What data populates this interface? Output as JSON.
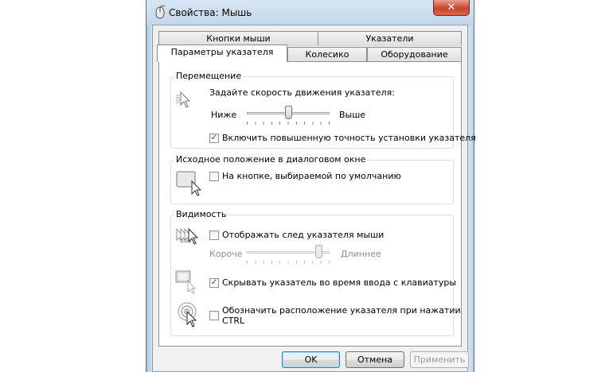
{
  "window": {
    "title": "Свойства: Мышь",
    "close_glyph": "✕",
    "icon": "mouse-icon"
  },
  "tabs": {
    "row1": [
      {
        "label": "Кнопки мыши",
        "active": false
      },
      {
        "label": "Указатели",
        "active": false
      }
    ],
    "row2": [
      {
        "label": "Параметры указателя",
        "active": true
      },
      {
        "label": "Колесико",
        "active": false
      },
      {
        "label": "Оборудование",
        "active": false
      }
    ]
  },
  "motion": {
    "group_label": "Перемещение",
    "speed_label": "Задайте скорость движения указателя:",
    "slow_label": "Ниже",
    "fast_label": "Выше",
    "speed_level": 0.5,
    "precision_label": "Включить повышенную точность установки указателя",
    "precision_checked": true
  },
  "snap": {
    "group_label": "Исходное положение в диалоговом окне",
    "snap_label": "На кнопке, выбираемой по умолчанию",
    "snap_checked": false
  },
  "visibility": {
    "group_label": "Видимость",
    "trails_label": "Отображать след указателя мыши",
    "trails_checked": false,
    "short_label": "Короче",
    "long_label": "Длиннее",
    "trails_level": 0.9,
    "hide_label": "Скрывать указатель во время ввода с клавиатуры",
    "hide_checked": true,
    "ctrl_label_line1": "Обозначить расположение указателя при нажатии",
    "ctrl_label_line2": "CTRL",
    "ctrl_checked": false
  },
  "buttons": {
    "ok": "OK",
    "cancel": "Отмена",
    "apply": "Применить"
  },
  "check_glyph": "✓",
  "colors": {
    "title_bar": "#c2d7ea",
    "close_button": "#c7432c",
    "default_button_border": "#3c7fb1"
  }
}
